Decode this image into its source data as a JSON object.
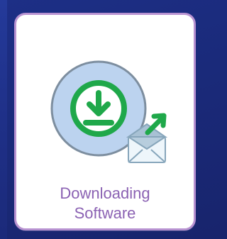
{
  "app": {
    "tile": {
      "label_line1": "Downloading",
      "label_line2": "Software",
      "icon_names": [
        "download-icon",
        "email-send-icon"
      ]
    }
  },
  "colors": {
    "background": "#1a2a7a",
    "tile_border": "#b892d1",
    "label": "#8b62b3",
    "circle_fill": "#bcd3ef",
    "circle_stroke": "#7d8e9f",
    "download_green": "#1fa84a",
    "mail_blue": "#8faec2"
  }
}
